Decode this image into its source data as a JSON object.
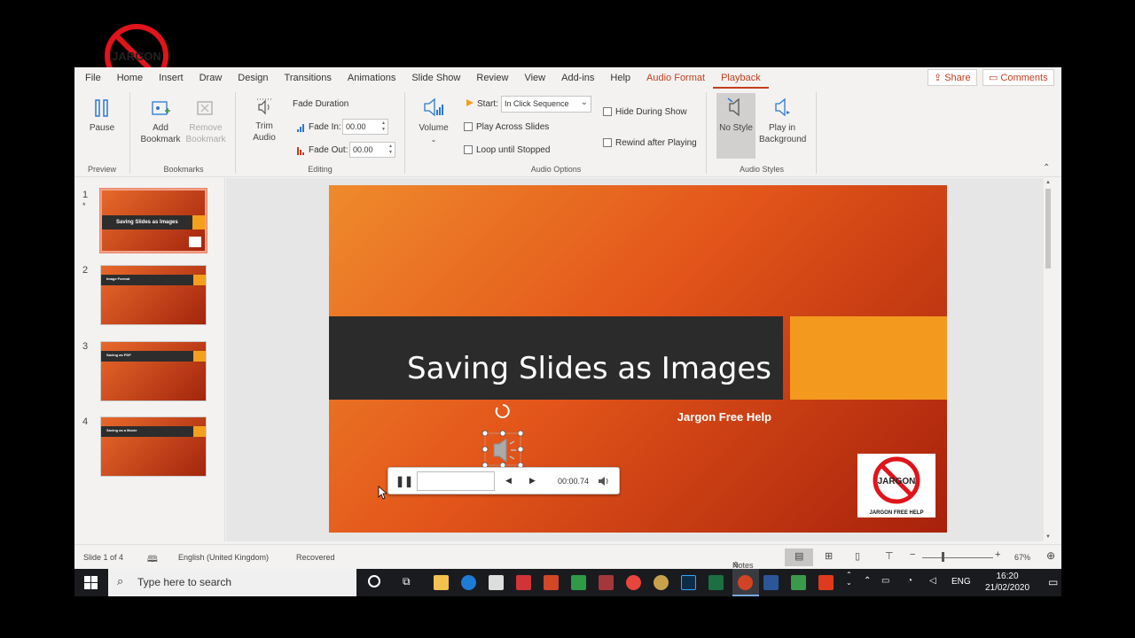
{
  "tabs": [
    "File",
    "Home",
    "Insert",
    "Draw",
    "Design",
    "Transitions",
    "Animations",
    "Slide Show",
    "Review",
    "View",
    "Add-ins",
    "Help",
    "Audio Format",
    "Playback"
  ],
  "tab_share": "Share",
  "tab_comments": "Comments",
  "ribbon": {
    "preview": {
      "pause": "Pause",
      "group": "Preview"
    },
    "bookmarks": {
      "add": "Add Bookmark",
      "remove": "Remove Bookmark",
      "group": "Bookmarks"
    },
    "editing": {
      "trim": "Trim Audio",
      "fade_duration": "Fade Duration",
      "fade_in_label": "Fade In:",
      "fade_in_value": "00.00",
      "fade_out_label": "Fade Out:",
      "fade_out_value": "00.00",
      "group": "Editing"
    },
    "audio_options": {
      "volume": "Volume",
      "start_label": "Start:",
      "start_value": "In Click Sequence",
      "play_across": "Play Across Slides",
      "loop": "Loop until Stopped",
      "hide": "Hide During Show",
      "rewind": "Rewind after Playing",
      "group": "Audio Options"
    },
    "audio_styles": {
      "no_style": "No Style",
      "play_bg": "Play in Background",
      "group": "Audio Styles"
    }
  },
  "thumbnails": [
    {
      "num": "1",
      "title": "Saving Slides as Images"
    },
    {
      "num": "2",
      "title": "Image Format"
    },
    {
      "num": "3",
      "title": "Saving as PDF"
    },
    {
      "num": "4",
      "title": "Saving as a Movie"
    }
  ],
  "slide": {
    "title": "Saving Slides as Images",
    "subtitle": "Jargon Free Help",
    "logo_caption": "JARGON FREE HELP"
  },
  "player": {
    "time": "00:00.74"
  },
  "status": {
    "slide": "Slide 1 of 4",
    "language": "English (United Kingdom)",
    "recovered": "Recovered",
    "notes": "Notes",
    "zoom": "67%"
  },
  "taskbar": {
    "search_placeholder": "Type here to search",
    "lang": "ENG",
    "time": "16:20",
    "date": "21/02/2020"
  },
  "colors": {
    "accent": "#c43e1c",
    "slide_orange": "#f39a1e",
    "slide_dark": "#2b2b2b"
  }
}
